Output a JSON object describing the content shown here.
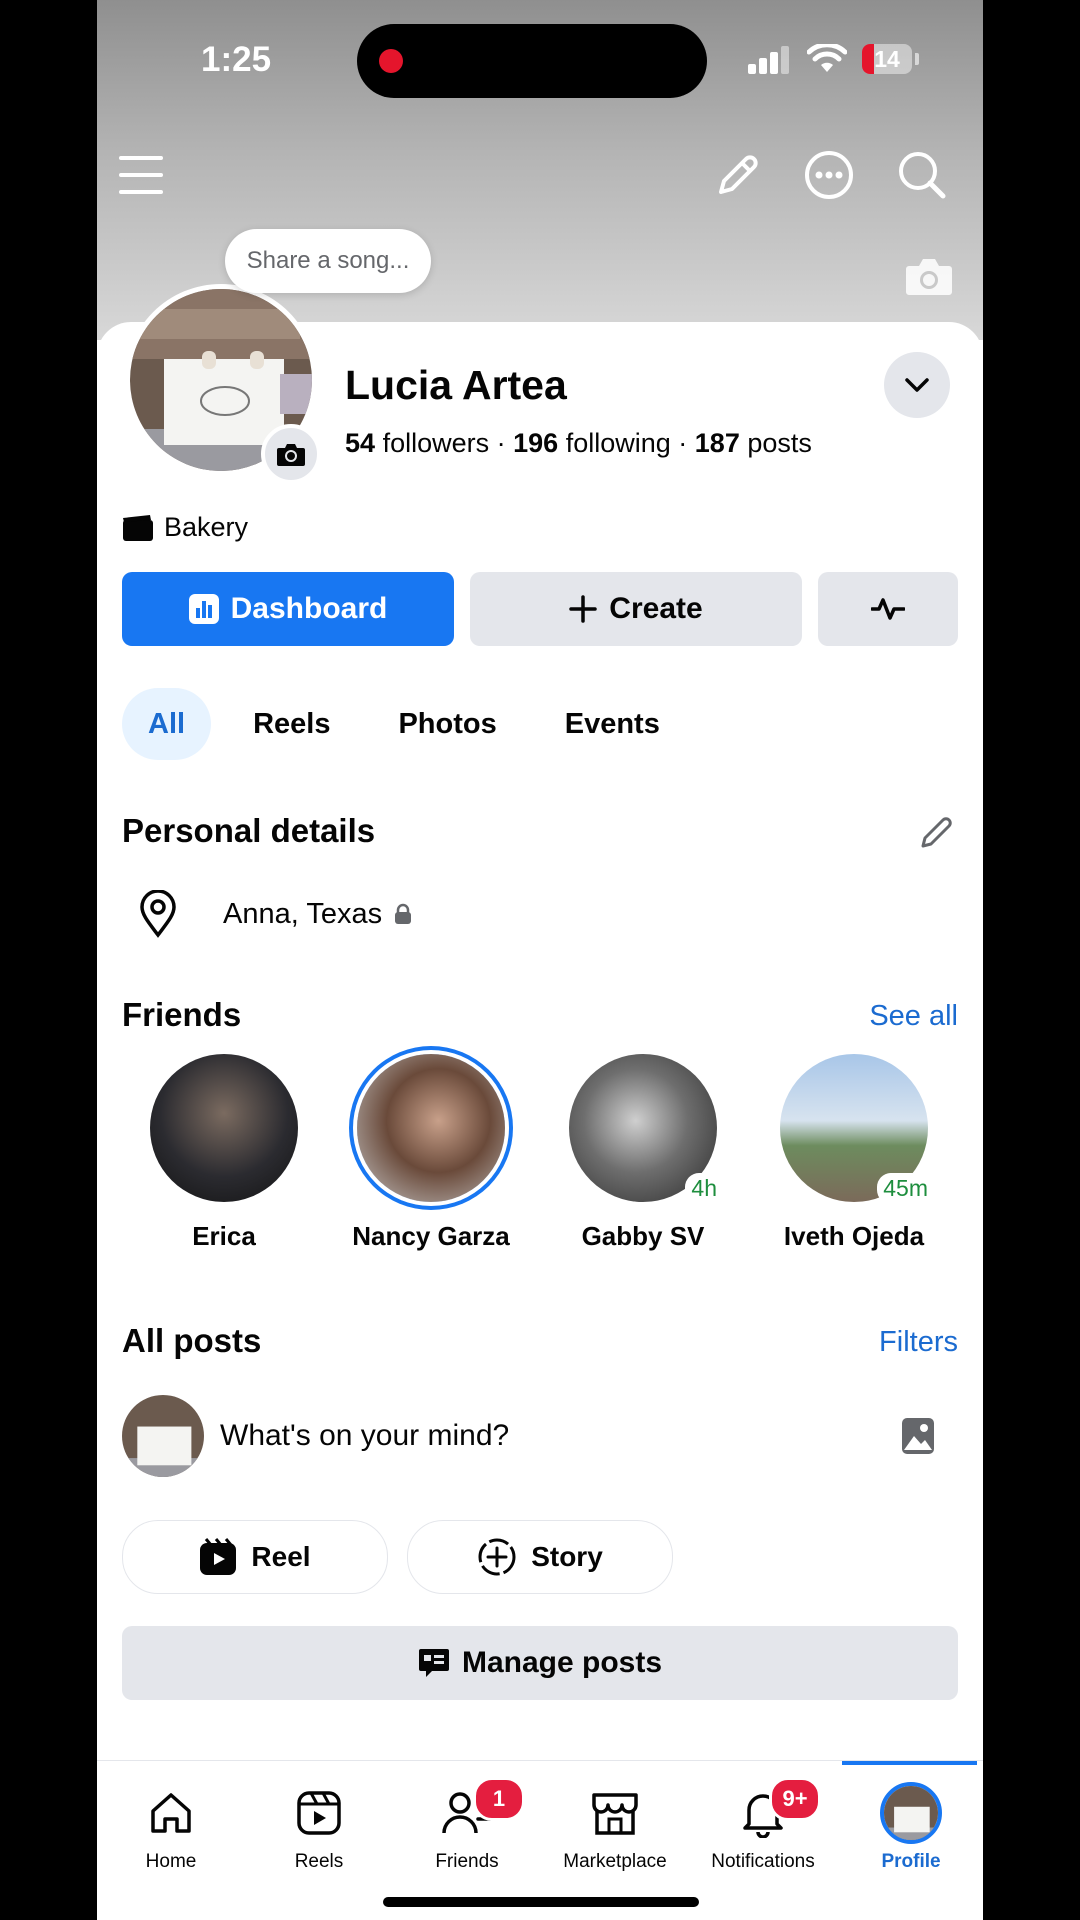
{
  "status_bar": {
    "time": "1:25",
    "battery": "14"
  },
  "header": {
    "menu_icon": "hamburger-menu-icon",
    "edit_icon": "pencil-icon",
    "more_icon": "more-dots-icon",
    "search_icon": "search-icon",
    "cover_camera_icon": "camera-icon"
  },
  "profile": {
    "song_prompt": "Share a song...",
    "name": "Lucia Artea",
    "followers_count": "54",
    "followers_label": "followers",
    "following_count": "196",
    "following_label": "following",
    "posts_count": "187",
    "posts_label": "posts",
    "category": "Bakery"
  },
  "actions": {
    "dashboard": "Dashboard",
    "create": "Create"
  },
  "tabs": [
    {
      "label": "All",
      "active": true
    },
    {
      "label": "Reels"
    },
    {
      "label": "Photos"
    },
    {
      "label": "Events"
    }
  ],
  "personal_details": {
    "title": "Personal details",
    "location": "Anna, Texas"
  },
  "friends": {
    "title": "Friends",
    "see_all": "See all",
    "items": [
      {
        "name": "Erica",
        "time": ""
      },
      {
        "name": "Nancy Garza",
        "time": ""
      },
      {
        "name": "Gabby SV",
        "time": "4h"
      },
      {
        "name": "Iveth Ojeda",
        "time": "45m"
      }
    ]
  },
  "posts": {
    "title": "All posts",
    "filters": "Filters",
    "composer_placeholder": "What's on your mind?",
    "reel": "Reel",
    "story": "Story",
    "manage": "Manage posts"
  },
  "bottom_nav": [
    {
      "label": "Home",
      "icon": "home-icon"
    },
    {
      "label": "Reels",
      "icon": "reels-icon"
    },
    {
      "label": "Friends",
      "icon": "friends-icon",
      "badge": "1"
    },
    {
      "label": "Marketplace",
      "icon": "marketplace-icon"
    },
    {
      "label": "Notifications",
      "icon": "bell-icon",
      "badge": "9+"
    },
    {
      "label": "Profile",
      "icon": "profile-avatar",
      "active": true
    }
  ],
  "colors": {
    "accent": "#1877f2",
    "badge": "#e41e3f",
    "online_time": "#1e8e3e"
  }
}
